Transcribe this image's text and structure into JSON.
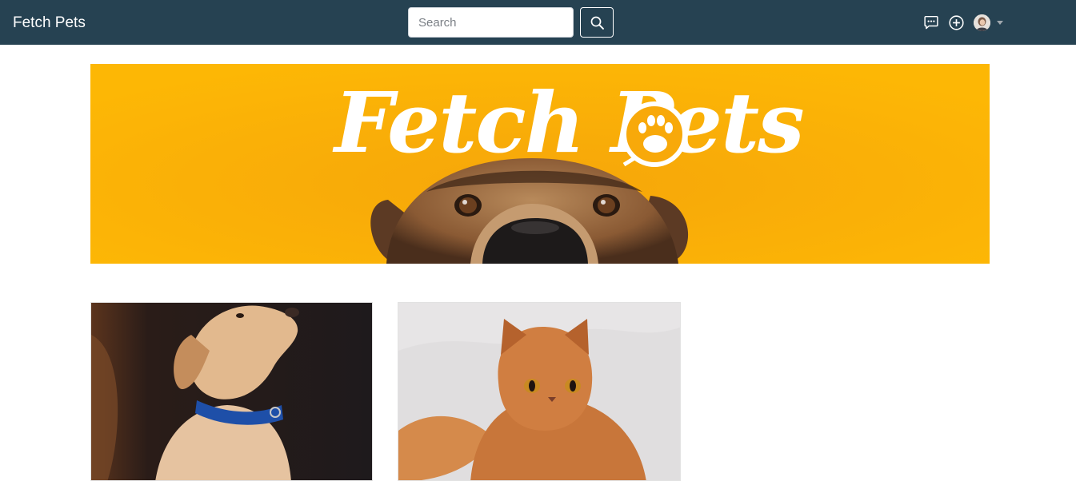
{
  "navbar": {
    "brand": "Fetch Pets",
    "search": {
      "placeholder": "Search",
      "value": ""
    },
    "icons": {
      "search": "search-icon",
      "messages": "chat-dots-icon",
      "add": "plus-circle-icon",
      "user": "user-avatar",
      "caret": "caret-down-icon"
    }
  },
  "banner": {
    "logo_text": "Fetch Pets",
    "background_color": "#FBB405"
  },
  "listings": [
    {
      "animal": "dog"
    },
    {
      "animal": "cat"
    }
  ],
  "colors": {
    "navbar": "#264252",
    "banner": "#FBB405"
  }
}
